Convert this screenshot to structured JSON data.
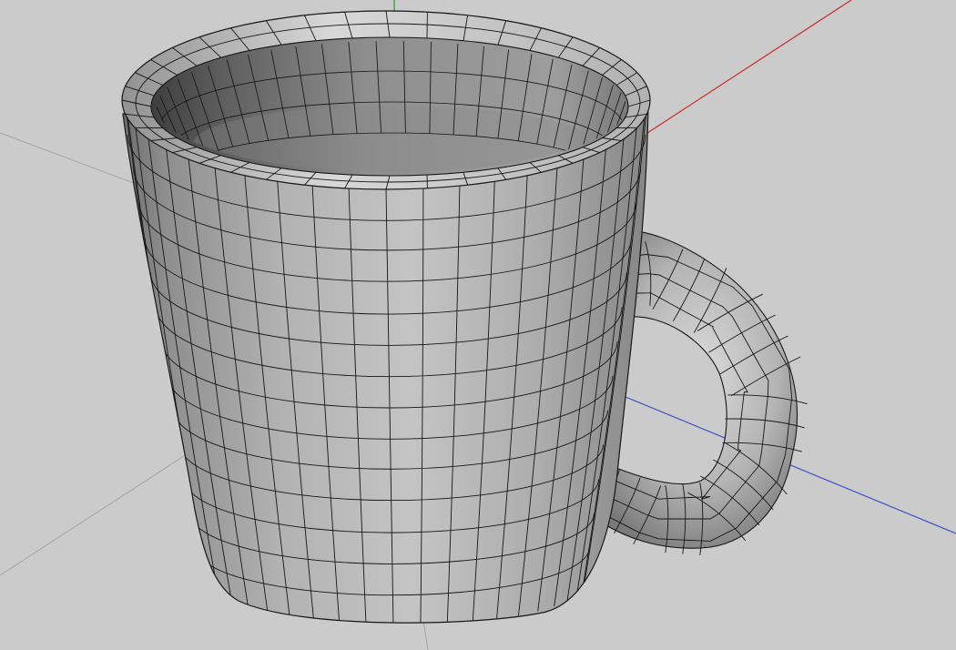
{
  "viewport": {
    "background_color": "#cbcbcb",
    "grid_line_color": "#a4a4a4"
  },
  "axes": [
    {
      "name": "x-axis",
      "color": "#cc2a2a"
    },
    {
      "name": "y-axis",
      "color": "#2a9a2a"
    },
    {
      "name": "z-axis",
      "color": "#3c4ccc"
    }
  ],
  "model": {
    "name": "mug",
    "display_mode": "shaded-with-wireframe",
    "wireframe_color": "#161616",
    "surface_color": "#a9a9a9"
  }
}
